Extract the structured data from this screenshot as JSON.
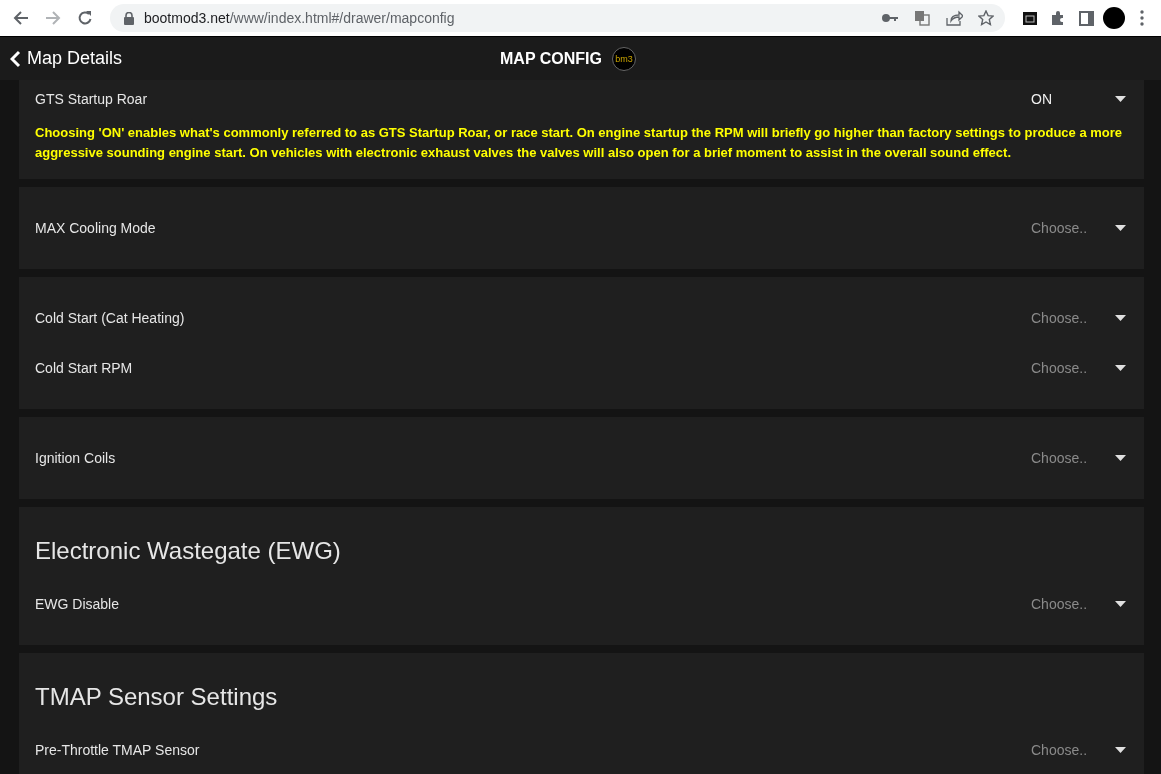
{
  "browser": {
    "url_domain": "bootmod3.net",
    "url_path": "/www/index.html#/drawer/mapconfig"
  },
  "header": {
    "back_label": "Map Details",
    "title": "MAP CONFIG",
    "logo_text": "bm3"
  },
  "sections": [
    {
      "settings": [
        {
          "label": "GTS Startup Roar",
          "value": "ON",
          "description": "Choosing 'ON' enables what's commonly referred to as GTS Startup Roar, or race start. On engine startup the RPM will briefly go higher than factory settings to produce a more aggressive sounding engine start. On vehicles with electronic exhaust valves the valves will also open for a brief moment to assist in the overall sound effect."
        }
      ]
    },
    {
      "settings": [
        {
          "label": "MAX Cooling Mode",
          "placeholder": "Choose.."
        }
      ]
    },
    {
      "settings": [
        {
          "label": "Cold Start (Cat Heating)",
          "placeholder": "Choose.."
        },
        {
          "label": "Cold Start RPM",
          "placeholder": "Choose.."
        }
      ]
    },
    {
      "settings": [
        {
          "label": "Ignition Coils",
          "placeholder": "Choose.."
        }
      ]
    },
    {
      "heading": "Electronic Wastegate (EWG)",
      "settings": [
        {
          "label": "EWG Disable",
          "placeholder": "Choose.."
        }
      ]
    },
    {
      "heading": "TMAP Sensor Settings",
      "settings": [
        {
          "label": "Pre-Throttle TMAP Sensor",
          "placeholder": "Choose.."
        }
      ]
    }
  ]
}
